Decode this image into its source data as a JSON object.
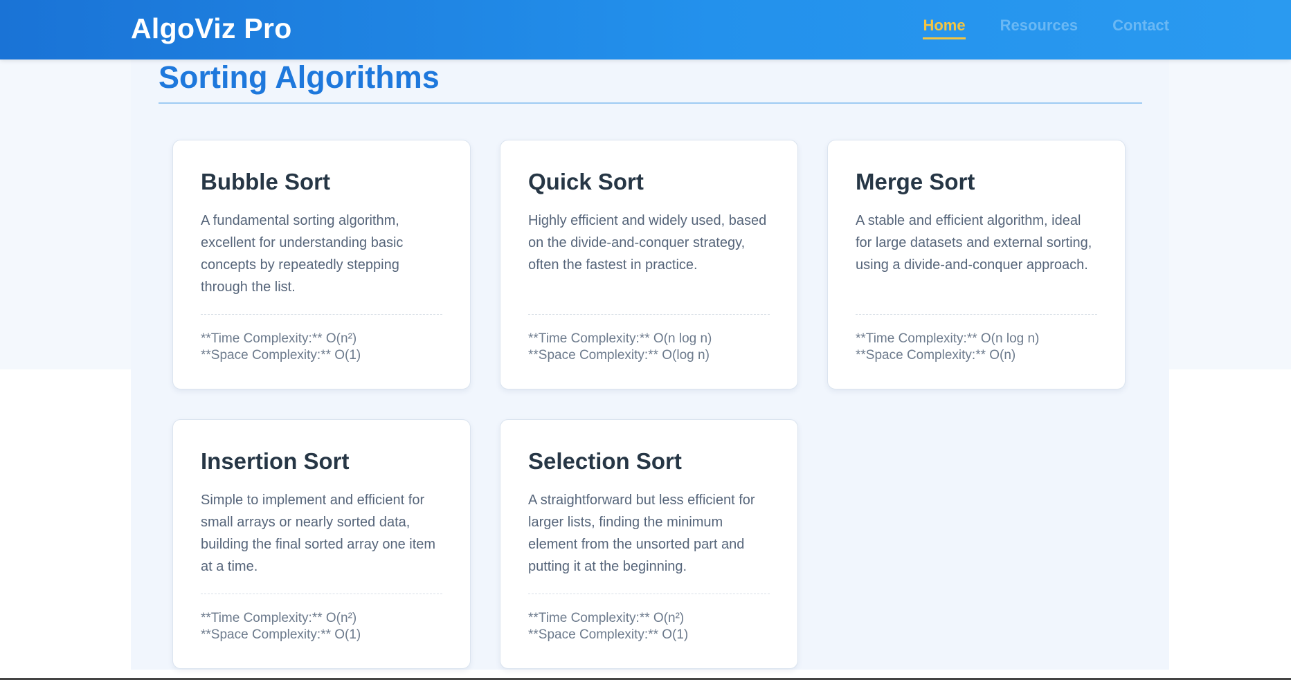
{
  "header": {
    "brand": "AlgoViz Pro",
    "nav": [
      {
        "label": "Home",
        "active": true
      },
      {
        "label": "Resources",
        "active": false
      },
      {
        "label": "Contact",
        "active": false
      }
    ]
  },
  "main": {
    "title": "Sorting Algorithms",
    "cards": [
      {
        "title": "Bubble Sort",
        "description": "A fundamental sorting algorithm, excellent for understanding basic concepts by repeatedly stepping through the list.",
        "time": "**Time Complexity:** O(n²)",
        "space": "**Space Complexity:** O(1)"
      },
      {
        "title": "Quick Sort",
        "description": "Highly efficient and widely used, based on the divide-and-conquer strategy, often the fastest in practice.",
        "time": "**Time Complexity:** O(n log n)",
        "space": "**Space Complexity:** O(log n)"
      },
      {
        "title": "Merge Sort",
        "description": "A stable and efficient algorithm, ideal for large datasets and external sorting, using a divide-and-conquer approach.",
        "time": "**Time Complexity:** O(n log n)",
        "space": "**Space Complexity:** O(n)"
      },
      {
        "title": "Insertion Sort",
        "description": "Simple to implement and efficient for small arrays or nearly sorted data, building the final sorted array one item at a time.",
        "time": "**Time Complexity:** O(n²)",
        "space": "**Space Complexity:** O(1)"
      },
      {
        "title": "Selection Sort",
        "description": "A straightforward but less efficient for larger lists, finding the minimum element from the unsorted part and putting it at the beginning.",
        "time": "**Time Complexity:** O(n²)",
        "space": "**Space Complexity:** O(1)"
      }
    ]
  },
  "colors": {
    "header_gradient_start": "#1a73d6",
    "header_gradient_end": "#2a9af0",
    "active_nav": "#f4c542",
    "inactive_nav": "#6ab8f4",
    "section_title": "#1e78dc",
    "card_title": "#263645",
    "card_text": "#56657a"
  }
}
